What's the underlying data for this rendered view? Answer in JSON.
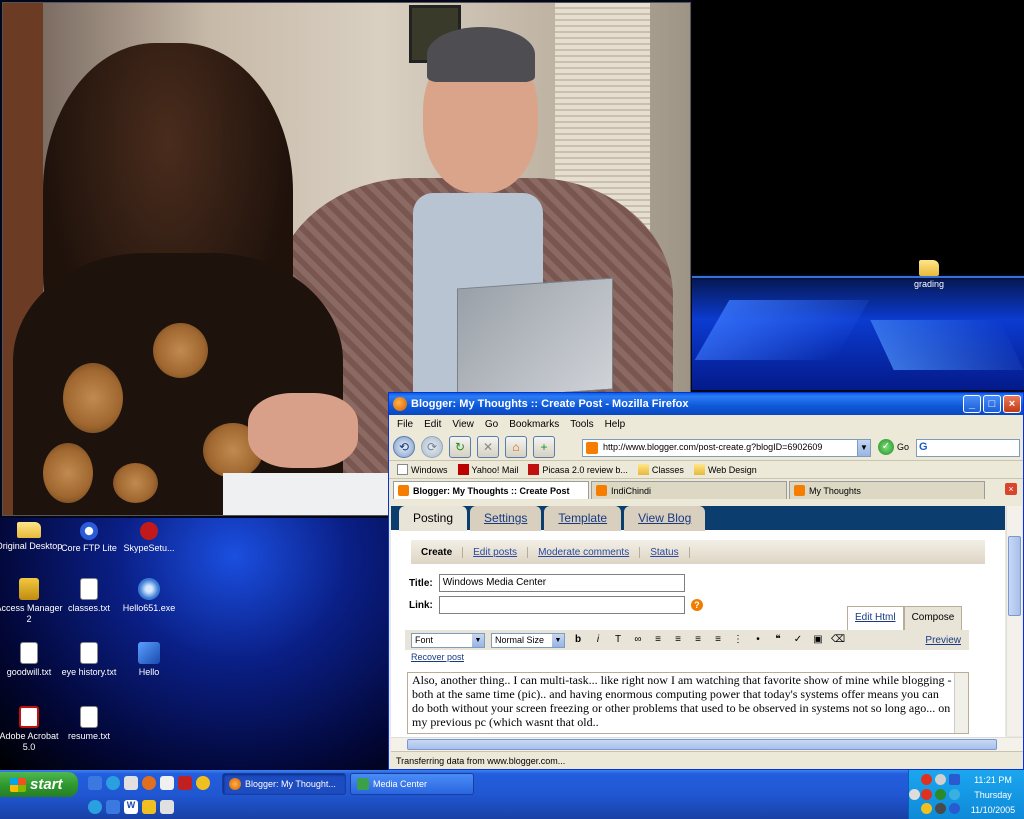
{
  "desktop": {
    "right_icons": [
      {
        "label": "grading",
        "icon": "folder-icon"
      }
    ],
    "left_icons": [
      {
        "label": "Original Desktop",
        "icon": "folder-icon"
      },
      {
        "label": "Core FTP Lite",
        "icon": "ftp-icon"
      },
      {
        "label": "SkypeSetu...",
        "icon": "skype-icon"
      },
      {
        "label": "Access Manager 2",
        "icon": "lock-icon"
      },
      {
        "label": "classes.txt",
        "icon": "text-file-icon"
      },
      {
        "label": "Hello651.exe",
        "icon": "exe-icon"
      },
      {
        "label": "goodwill.txt",
        "icon": "text-file-icon"
      },
      {
        "label": "eye history.txt",
        "icon": "text-file-icon"
      },
      {
        "label": "Hello",
        "icon": "hello-icon"
      },
      {
        "label": "Adobe Acrobat 5.0",
        "icon": "acrobat-icon"
      },
      {
        "label": "resume.txt",
        "icon": "text-file-icon"
      }
    ]
  },
  "firefox": {
    "title": "Blogger: My Thoughts :: Create Post - Mozilla Firefox",
    "menu": [
      "File",
      "Edit",
      "View",
      "Go",
      "Bookmarks",
      "Tools",
      "Help"
    ],
    "url": "http://www.blogger.com/post-create.g?blogID=6902609",
    "go_label": "Go",
    "bookmarks": [
      "Windows",
      "Yahoo! Mail",
      "Picasa 2.0 review b...",
      "Classes",
      "Web Design"
    ],
    "tabs": [
      "Blogger: My Thoughts :: Create Post",
      "IndiChindi",
      "My Thoughts"
    ],
    "status": "Transferring data from www.blogger.com..."
  },
  "blogger": {
    "main_tabs": [
      "Posting",
      "Settings",
      "Template",
      "View Blog"
    ],
    "sub_tabs": [
      "Create",
      "Edit posts",
      "Moderate comments",
      "Status"
    ],
    "title_label": "Title:",
    "title_value": "Windows Media Center",
    "link_label": "Link:",
    "link_value": "",
    "help_symbol": "?",
    "edit_modes": [
      "Edit Html",
      "Compose"
    ],
    "font_select": "Font",
    "size_select": "Normal Size",
    "preview_label": "Preview",
    "recover_label": "Recover post",
    "post_body": "Also, another thing.. I can multi-task... like right now I am watching that favorite show of mine while blogging - both at the same time (pic).. and having enormous computing power that today's systems offer means you can do both without your screen freezing or other problems that used to be observed in systems not so long ago... on my previous pc (which wasnt that old.."
  },
  "taskbar": {
    "start_label": "start",
    "tasks": [
      "Blogger: My Thought...",
      "Media Center"
    ],
    "time": "11:21 PM",
    "day": "Thursday",
    "date": "11/10/2005"
  }
}
